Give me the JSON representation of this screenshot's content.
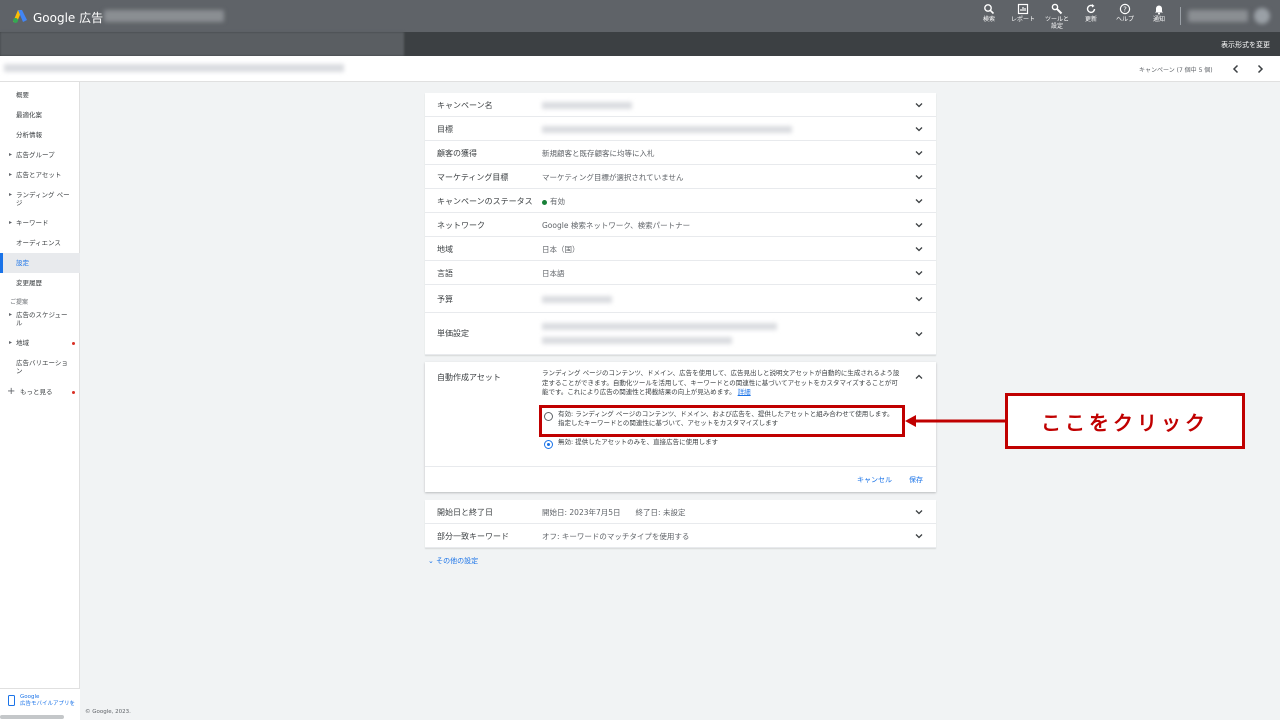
{
  "app": {
    "brand": "Google 広告"
  },
  "toolbar": [
    {
      "label": "検索",
      "icon": "search-icon"
    },
    {
      "label": "レポート",
      "icon": "report-icon"
    },
    {
      "label": "ツールと\n設定",
      "icon": "wrench-icon"
    },
    {
      "label": "更新",
      "icon": "refresh-icon"
    },
    {
      "label": "ヘルプ",
      "icon": "help-icon"
    },
    {
      "label": "通知",
      "icon": "bell-icon"
    }
  ],
  "header": {
    "view_toggle": "表示形式を変更",
    "campaign_count": "キャンペーン (7 個中 5 個)"
  },
  "sidebar": {
    "items": [
      {
        "label": "概要"
      },
      {
        "label": "最適化案"
      },
      {
        "label": "分析情報"
      },
      {
        "label": "広告グループ"
      },
      {
        "label": "広告とアセット"
      },
      {
        "label": "ランディング ページ"
      },
      {
        "label": "キーワード"
      },
      {
        "label": "オーディエンス"
      },
      {
        "label": "設定"
      },
      {
        "label": "変更履歴"
      }
    ],
    "section": "ご提案",
    "more_items": [
      {
        "label": "広告のスケジュール"
      },
      {
        "label": "地域"
      },
      {
        "label": "広告バリエーション"
      },
      {
        "label": "もっと見る"
      }
    ],
    "footer": "Google\n広告モバイルアプリを"
  },
  "settings": {
    "campaign_name": {
      "label": "キャンペーン名"
    },
    "goal": {
      "label": "目標"
    },
    "customer_acquisition": {
      "label": "顧客の獲得",
      "value": "新規顧客と既存顧客に均等に入札"
    },
    "marketing_goal": {
      "label": "マーケティング目標",
      "value": "マーケティング目標が選択されていません"
    },
    "campaign_status": {
      "label": "キャンペーンのステータス",
      "value": "有効"
    },
    "network": {
      "label": "ネットワーク",
      "value": "Google 検索ネットワーク、検索パートナー"
    },
    "location": {
      "label": "地域",
      "value": "日本（国）"
    },
    "language": {
      "label": "言語",
      "value": "日本語"
    },
    "budget": {
      "label": "予算"
    },
    "bidding": {
      "label": "単価設定"
    },
    "auto_assets": {
      "label": "自動作成アセット",
      "description": "ランディング ページのコンテンツ、ドメイン、広告を使用して、広告見出しと説明文アセットが自動的に生成されるよう設定することができます。自動化ツールを活用して、キーワードとの関連性に基づいてアセットをカスタマイズすることが可能です。これにより広告の関連性と掲載結果の向上が見込めます。",
      "details_link": "詳細",
      "option_on": "有効: ランディング ページのコンテンツ、ドメイン、および広告を、提供したアセットと組み合わせて使用します。指定したキーワードとの関連性に基づいて、アセットをカスタマイズします",
      "option_off": "無効: 提供したアセットのみを、直接広告に使用します",
      "cancel": "キャンセル",
      "save": "保存"
    },
    "dates": {
      "label": "開始日と終了日",
      "value": "開始日: 2023年7月5日　　終了日: 未設定"
    },
    "broad_match": {
      "label": "部分一致キーワード",
      "value": "オフ: キーワードのマッチタイプを使用する"
    },
    "more": "その他の設定"
  },
  "annotation": {
    "callout": "ここをクリック",
    "color": "#c00000"
  },
  "footer": {
    "copyright": "© Google, 2023."
  }
}
